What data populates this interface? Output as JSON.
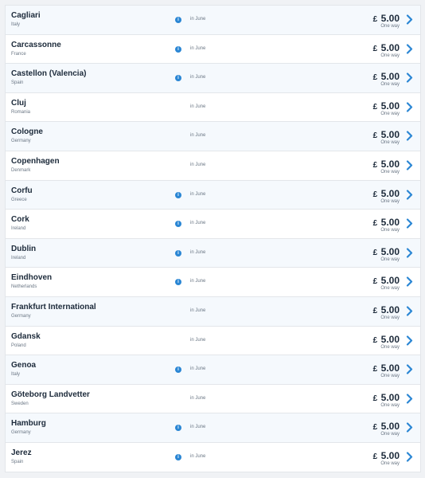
{
  "routes": [
    {
      "city": "Cagliari",
      "country": "Italy",
      "info": true,
      "when": "in June",
      "currency": "£",
      "price": "5.00",
      "fare_type": "One way"
    },
    {
      "city": "Carcassonne",
      "country": "France",
      "info": true,
      "when": "in June",
      "currency": "£",
      "price": "5.00",
      "fare_type": "One way"
    },
    {
      "city": "Castellon (Valencia)",
      "country": "Spain",
      "info": true,
      "when": "in June",
      "currency": "£",
      "price": "5.00",
      "fare_type": "One way"
    },
    {
      "city": "Cluj",
      "country": "Romania",
      "info": false,
      "when": "in June",
      "currency": "£",
      "price": "5.00",
      "fare_type": "One way"
    },
    {
      "city": "Cologne",
      "country": "Germany",
      "info": false,
      "when": "in June",
      "currency": "£",
      "price": "5.00",
      "fare_type": "One way"
    },
    {
      "city": "Copenhagen",
      "country": "Denmark",
      "info": false,
      "when": "in June",
      "currency": "£",
      "price": "5.00",
      "fare_type": "One way"
    },
    {
      "city": "Corfu",
      "country": "Greece",
      "info": true,
      "when": "in June",
      "currency": "£",
      "price": "5.00",
      "fare_type": "One way"
    },
    {
      "city": "Cork",
      "country": "Ireland",
      "info": true,
      "when": "in June",
      "currency": "£",
      "price": "5.00",
      "fare_type": "One way"
    },
    {
      "city": "Dublin",
      "country": "Ireland",
      "info": true,
      "when": "in June",
      "currency": "£",
      "price": "5.00",
      "fare_type": "One way"
    },
    {
      "city": "Eindhoven",
      "country": "Netherlands",
      "info": true,
      "when": "in June",
      "currency": "£",
      "price": "5.00",
      "fare_type": "One way"
    },
    {
      "city": "Frankfurt International",
      "country": "Germany",
      "info": false,
      "when": "in June",
      "currency": "£",
      "price": "5.00",
      "fare_type": "One way"
    },
    {
      "city": "Gdansk",
      "country": "Poland",
      "info": false,
      "when": "in June",
      "currency": "£",
      "price": "5.00",
      "fare_type": "One way"
    },
    {
      "city": "Genoa",
      "country": "Italy",
      "info": true,
      "when": "in June",
      "currency": "£",
      "price": "5.00",
      "fare_type": "One way"
    },
    {
      "city": "Göteborg Landvetter",
      "country": "Sweden",
      "info": false,
      "when": "in June",
      "currency": "£",
      "price": "5.00",
      "fare_type": "One way"
    },
    {
      "city": "Hamburg",
      "country": "Germany",
      "info": true,
      "when": "in June",
      "currency": "£",
      "price": "5.00",
      "fare_type": "One way"
    },
    {
      "city": "Jerez",
      "country": "Spain",
      "info": true,
      "when": "in June",
      "currency": "£",
      "price": "5.00",
      "fare_type": "One way"
    }
  ],
  "icons": {
    "info": "info-icon",
    "chevron": "chevron-right-icon",
    "info_glyph": "i"
  },
  "colors": {
    "accent": "#2a86d4",
    "text": "#1c2a3a",
    "muted": "#6b7785",
    "row_alt": "#f5f9fd"
  }
}
